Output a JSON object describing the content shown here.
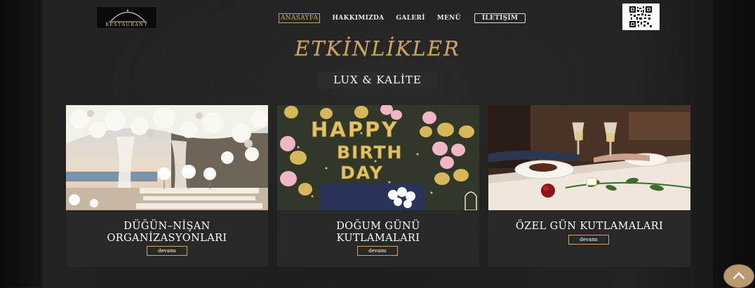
{
  "brand": {
    "logo_text": "RESTAURANT"
  },
  "nav": {
    "home": "ANASAYFA",
    "about": "HAKKIMIZDA",
    "gallery": "GALERİ",
    "menu": "MENÜ",
    "contact": "İLETİŞİM"
  },
  "section": {
    "heading": "ETKİNLİKLER",
    "subtitle": "LUX & KALİTE"
  },
  "cards": [
    {
      "title_line1": "DÜĞÜN–NİŞAN",
      "title_line2": "ORGANİZASYONLARI",
      "button": "devamı",
      "image": "wedding-photo"
    },
    {
      "title_line1": "DOĞUM GÜNÜ",
      "title_line2": "KUTLAMALARI",
      "button": "devamı",
      "image": "birthday-photo"
    },
    {
      "title_line1": "ÖZEL GÜN KUTLAMALARI",
      "title_line2": "",
      "button": "devamı",
      "image": "dinner-photo"
    }
  ],
  "photo_text": {
    "balloon_letters": "HAPPY BIRTHDAY"
  },
  "icons": {
    "qr": "qr-code-icon",
    "scroll_top": "chevron-up-icon"
  },
  "colors": {
    "accent_gold": "#c9a96b",
    "heading_gold": "#c9a565",
    "card_bg": "#282828",
    "page_bg": "#1b1b1b"
  }
}
